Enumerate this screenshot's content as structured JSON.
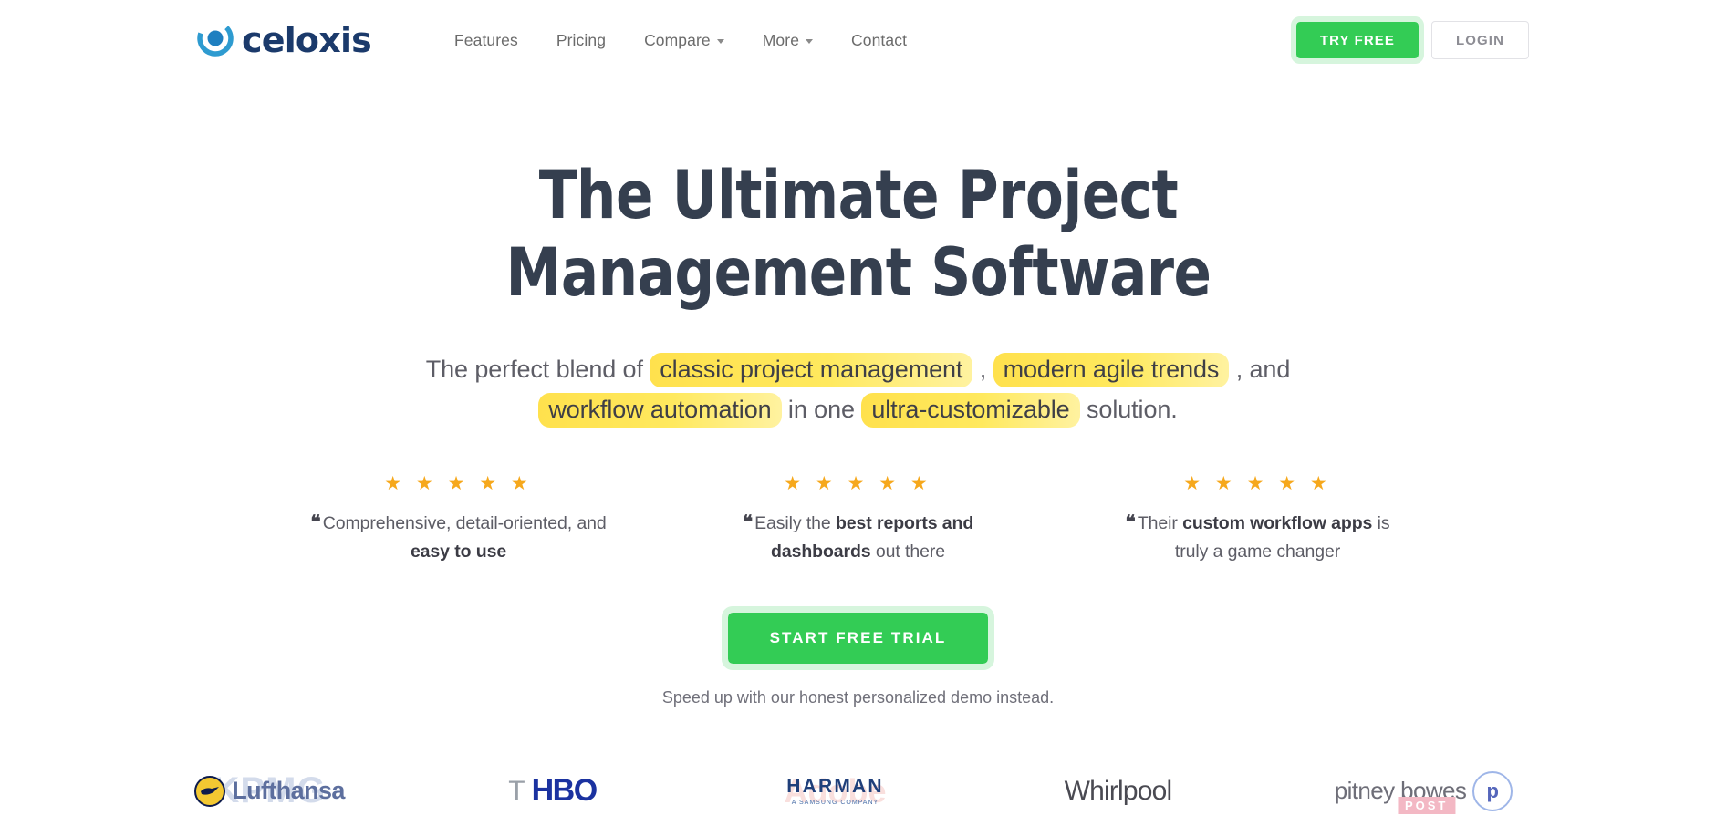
{
  "header": {
    "logo_text": "celoxis",
    "logo_icon": "celoxis-c-mark-icon",
    "nav": [
      {
        "label": "Features",
        "has_caret": false
      },
      {
        "label": "Pricing",
        "has_caret": false
      },
      {
        "label": "Compare",
        "has_caret": true
      },
      {
        "label": "More",
        "has_caret": true
      },
      {
        "label": "Contact",
        "has_caret": false
      }
    ],
    "try_free_label": "TRY FREE",
    "login_label": "LOGIN"
  },
  "hero": {
    "headline": "The Ultimate Project Management Software",
    "subhead": {
      "part1": "The perfect blend of ",
      "hl1": "classic project management",
      "part2": " , ",
      "hl2": "modern agile trends",
      "part3": " , and ",
      "hl3": "workflow automation",
      "part4": " in one ",
      "hl4": "ultra-customizable",
      "part5": " solution."
    }
  },
  "testimonials": [
    {
      "stars": "★ ★ ★ ★ ★",
      "rating": 5,
      "quote_mark": "❝",
      "text_before": "Comprehensive, detail-oriented, and ",
      "text_bold": "easy to use",
      "text_after": ""
    },
    {
      "stars": "★ ★ ★ ★ ★",
      "rating": 5,
      "quote_mark": "❝",
      "text_before": "Easily the ",
      "text_bold": "best reports and dashboards",
      "text_after": " out there"
    },
    {
      "stars": "★ ★ ★ ★ ★",
      "rating": 5,
      "quote_mark": "❝",
      "text_before": "Their ",
      "text_bold": "custom workflow apps",
      "text_after": " is truly a game changer"
    }
  ],
  "cta": {
    "button_label": "START FREE TRIAL",
    "demo_link_label": "Speed up with our honest personalized demo instead."
  },
  "client_logos": [
    {
      "name": "Lufthansa",
      "ghost": "KPMG"
    },
    {
      "name": "HBO",
      "ghost": "Tesla"
    },
    {
      "name": "HARMAN",
      "subtitle": "A SAMSUNG COMPANY",
      "ghost": "Adobe"
    },
    {
      "name": "Whirlpool",
      "ghost": ""
    },
    {
      "name": "pitney bowes",
      "ghost": "POST"
    }
  ],
  "colors": {
    "brand_green": "#33cc55",
    "green_ring": "#d6f5dd",
    "logo_blue": "#1b3a6b",
    "logo_mark_blue": "#2e9bd0",
    "headline_navy": "#353f4f",
    "highlight_yellow": "#ffe14d",
    "star_amber": "#f6a81c",
    "body_gray": "#5d5d66"
  }
}
